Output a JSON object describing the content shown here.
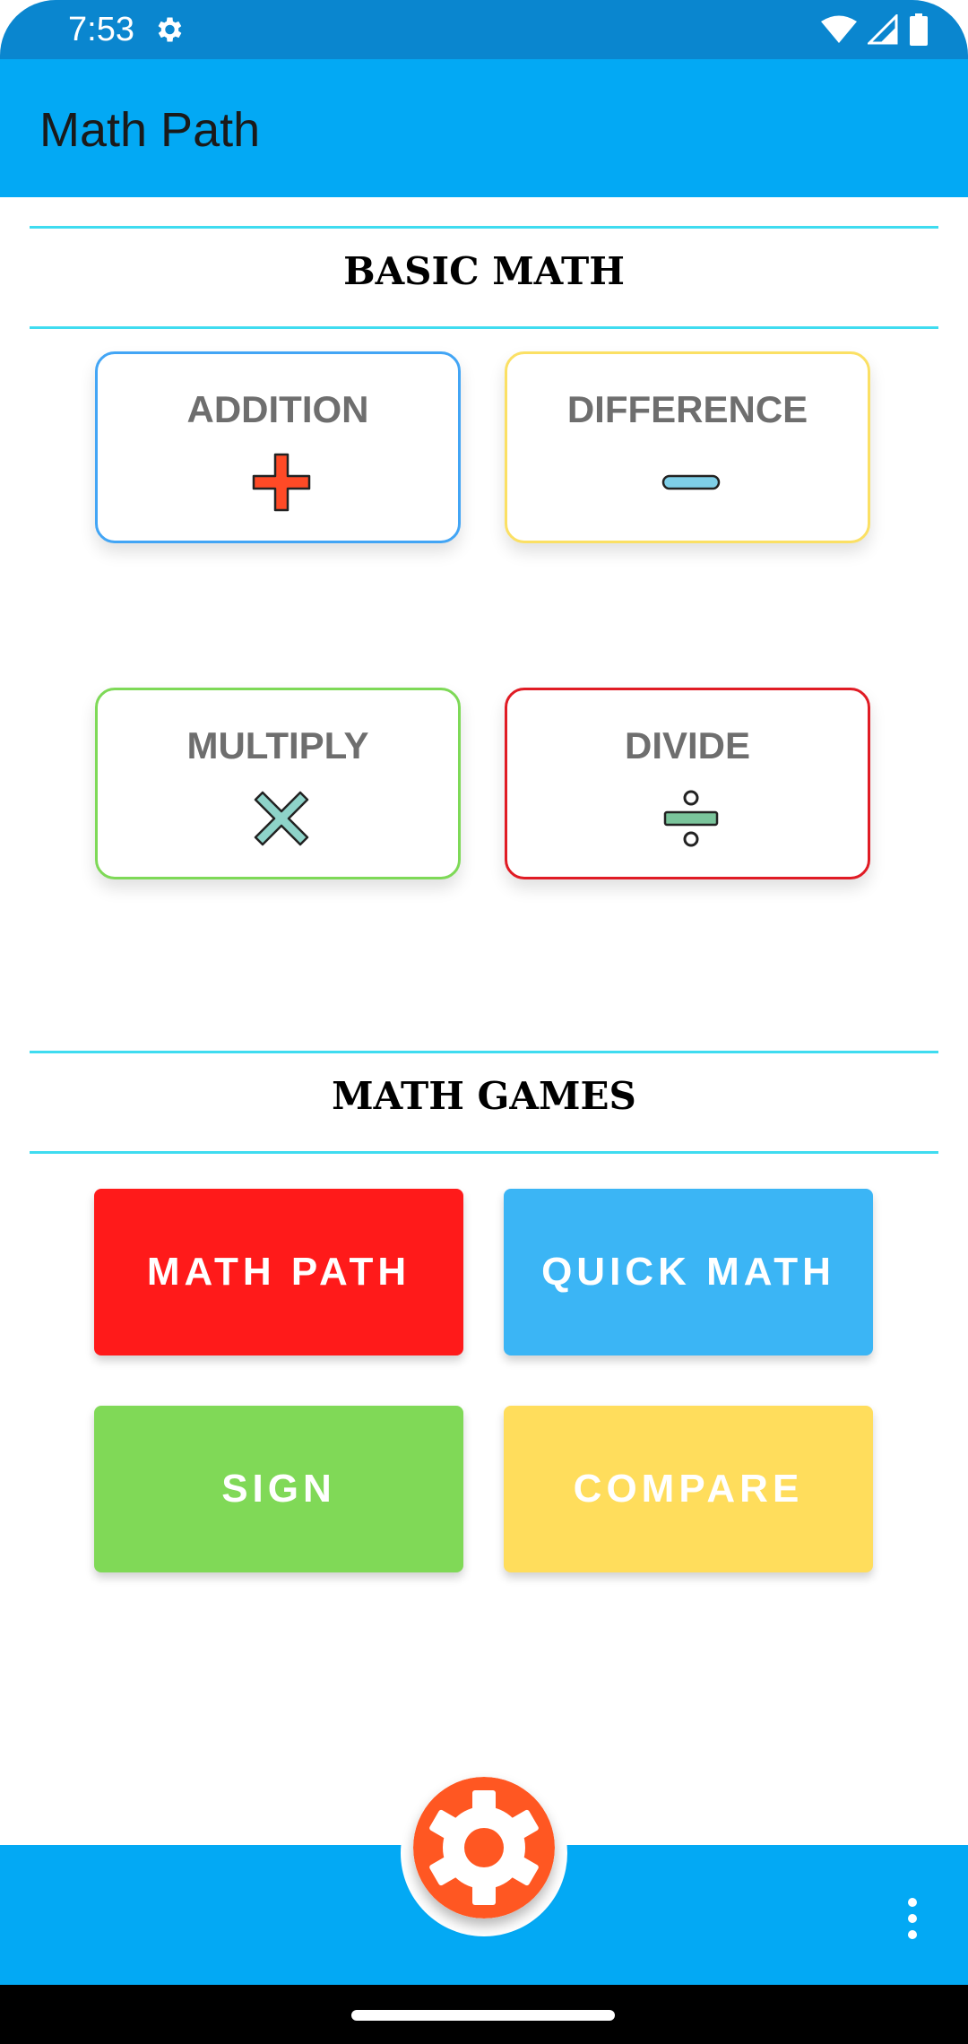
{
  "status_bar": {
    "time": "7:53"
  },
  "app_bar": {
    "title": "Math Path"
  },
  "basic_math": {
    "title": "BASIC MATH",
    "cards": [
      {
        "label": "ADDITION",
        "icon": "plus-icon",
        "border_color": "#42a5f5"
      },
      {
        "label": "DIFFERENCE",
        "icon": "minus-icon",
        "border_color": "#fbe064"
      },
      {
        "label": "MULTIPLY",
        "icon": "multiply-icon",
        "border_color": "#7ed957"
      },
      {
        "label": "DIVIDE",
        "icon": "divide-icon",
        "border_color": "#e01b24"
      }
    ]
  },
  "math_games": {
    "title": "MATH GAMES",
    "buttons": [
      {
        "label": "MATH PATH",
        "color": "#ff1a1a"
      },
      {
        "label": "QUICK MATH",
        "color": "#3bb5f5"
      },
      {
        "label": "SIGN",
        "color": "#80d957"
      },
      {
        "label": "COMPARE",
        "color": "#ffdd5c"
      }
    ]
  },
  "bottom_bar": {
    "fab_icon": "gear-icon",
    "menu_icon": "more-vert-icon"
  },
  "colors": {
    "primary": "#03a9f4",
    "status": "#0a86cf",
    "divider": "#3fdcf0",
    "fab": "#ff5722"
  }
}
